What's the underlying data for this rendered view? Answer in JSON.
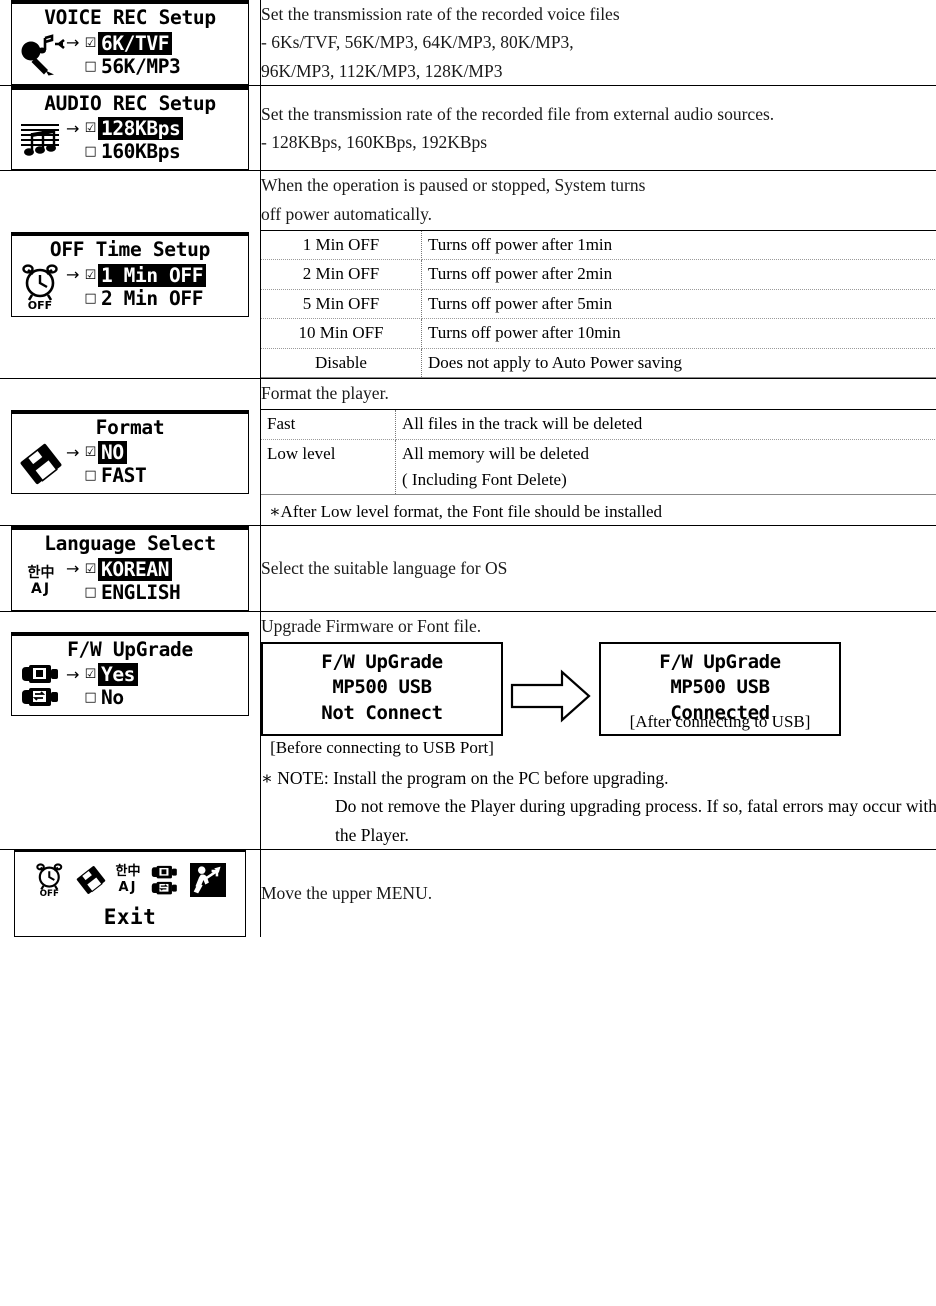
{
  "rows": [
    {
      "id": "voice-rec-setup",
      "panel": {
        "title": "VOICE REC Setup",
        "icon": "microphone-music-note-icon",
        "options": [
          {
            "label": "6K/TVF",
            "selected": true,
            "arrow": "→",
            "box": "☑"
          },
          {
            "label": "56K/MP3",
            "selected": false,
            "arrow": "",
            "box": "□"
          }
        ]
      },
      "description": {
        "lines": [
          "Set the transmission rate of the recorded voice files",
          "- 6Ks/TVF, 56K/MP3, 64K/MP3, 80K/MP3,",
          "96K/MP3, 112K/MP3, 128K/MP3"
        ]
      }
    },
    {
      "id": "audio-rec-setup",
      "panel": {
        "title": "AUDIO REC Setup",
        "icon": "music-staff-icon",
        "options": [
          {
            "label": "128KBps",
            "selected": true,
            "arrow": "→",
            "box": "☑"
          },
          {
            "label": "160KBps",
            "selected": false,
            "arrow": "",
            "box": "□"
          }
        ]
      },
      "description": {
        "lines": [
          "Set the transmission rate of the recorded file from external audio sources.",
          "- 128KBps, 160KBps, 192KBps"
        ]
      }
    },
    {
      "id": "off-time-setup",
      "panel": {
        "title": "OFF Time Setup",
        "icon": "alarm-clock-off-icon",
        "options": [
          {
            "label": "1 Min OFF",
            "selected": true,
            "arrow": "→",
            "box": "☑"
          },
          {
            "label": "2 Min OFF",
            "selected": false,
            "arrow": "",
            "box": "□"
          }
        ]
      },
      "description": {
        "intro": [
          "When the operation is paused or stopped, System turns",
          "off power automatically."
        ],
        "table": [
          {
            "key": "1 Min OFF",
            "value": "Turns off power after 1min"
          },
          {
            "key": "2 Min OFF",
            "value": "Turns off power after 2min"
          },
          {
            "key": "5 Min OFF",
            "value": "Turns off power after 5min"
          },
          {
            "key": "10 Min OFF",
            "value": "Turns off power after 10min"
          },
          {
            "key": "Disable",
            "value": "Does not apply to Auto Power saving"
          }
        ]
      }
    },
    {
      "id": "format",
      "panel": {
        "title": "Format",
        "icon": "floppy-disk-icon",
        "options": [
          {
            "label": "NO",
            "selected": true,
            "arrow": "→",
            "box": "☑"
          },
          {
            "label": "FAST",
            "selected": false,
            "arrow": "",
            "box": "□"
          }
        ]
      },
      "description": {
        "intro": [
          "Format the player."
        ],
        "table": [
          {
            "key": "Fast",
            "value": "All files in the track will be deleted"
          },
          {
            "key": "Low level",
            "value": "All memory will be deleted\n( Including Font Delete)"
          }
        ],
        "footnote": "∗After Low level format, the Font file should be installed"
      }
    },
    {
      "id": "language-select",
      "panel": {
        "title": "Language Select",
        "icon": "language-icon",
        "icon_glyphs": [
          "한",
          "中",
          "A",
          "J"
        ],
        "options": [
          {
            "label": "KOREAN",
            "selected": true,
            "arrow": "→",
            "box": "☑"
          },
          {
            "label": "ENGLISH",
            "selected": false,
            "arrow": "",
            "box": "□"
          }
        ]
      },
      "description": {
        "lines": [
          "Select the suitable language for OS"
        ]
      }
    },
    {
      "id": "fw-upgrade",
      "panel": {
        "title": "F/W UpGrade",
        "icon": "firmware-usb-icon",
        "options": [
          {
            "label": "Yes",
            "selected": true,
            "arrow": "→",
            "box": "☑"
          },
          {
            "label": "No",
            "selected": false,
            "arrow": "",
            "box": "□"
          }
        ]
      },
      "description": {
        "intro": [
          "Upgrade Firmware or Font file."
        ],
        "diagram": {
          "before": {
            "lines": [
              "F/W UpGrade",
              "MP500 USB",
              "Not Connect"
            ],
            "caption": "[Before connecting to USB Port]"
          },
          "arrow_icon": "right-arrow-outline-icon",
          "after": {
            "lines": [
              "F/W UpGrade",
              "MP500 USB",
              "Connected"
            ],
            "caption": "[After connecting to USB]"
          }
        },
        "note": {
          "first": "∗ NOTE: Install the program on the PC before upgrading.",
          "rest": [
            "Do not remove the Player during upgrading process. If so, fatal errors may occur with the Player."
          ]
        }
      }
    },
    {
      "id": "exit",
      "panel": {
        "title": "",
        "icon": "exit-icon-strip",
        "strip_icons": [
          "alarm-clock-off-icon",
          "floppy-disk-icon",
          "language-icon",
          "firmware-usb-icon",
          "exit-running-person-icon"
        ],
        "exit_label": "Exit"
      },
      "description": {
        "lines": [
          "Move the upper MENU."
        ]
      }
    }
  ],
  "colors": {
    "ink": "#000000",
    "paper": "#ffffff",
    "prose": "#1a1a1a",
    "rule": "#9a9a9a"
  }
}
